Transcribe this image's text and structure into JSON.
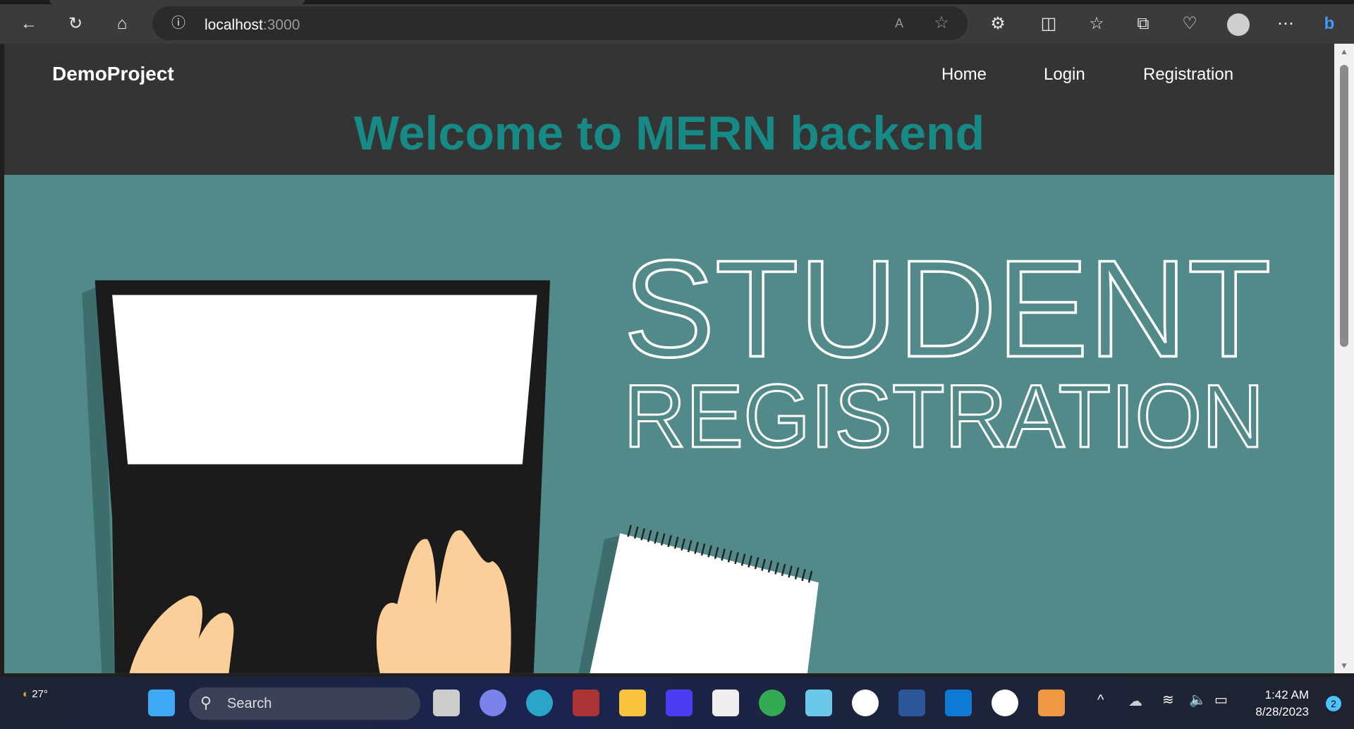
{
  "browser": {
    "url_host": "localhost",
    "url_port": ":3000"
  },
  "navbar": {
    "brand": "DemoProject",
    "links": [
      "Home",
      "Login",
      "Registration"
    ]
  },
  "page": {
    "heading": "Welcome to MERN backend",
    "hero_line1": "STUDENT",
    "hero_line2": "REGISTRATION"
  },
  "taskbar": {
    "weather": "27°",
    "search_placeholder": "Search",
    "time": "1:42 AM",
    "date": "8/28/2023",
    "notifications": "2"
  },
  "colors": {
    "heading": "#178a86",
    "hero_bg": "#518a89",
    "navbar": "#343434"
  }
}
